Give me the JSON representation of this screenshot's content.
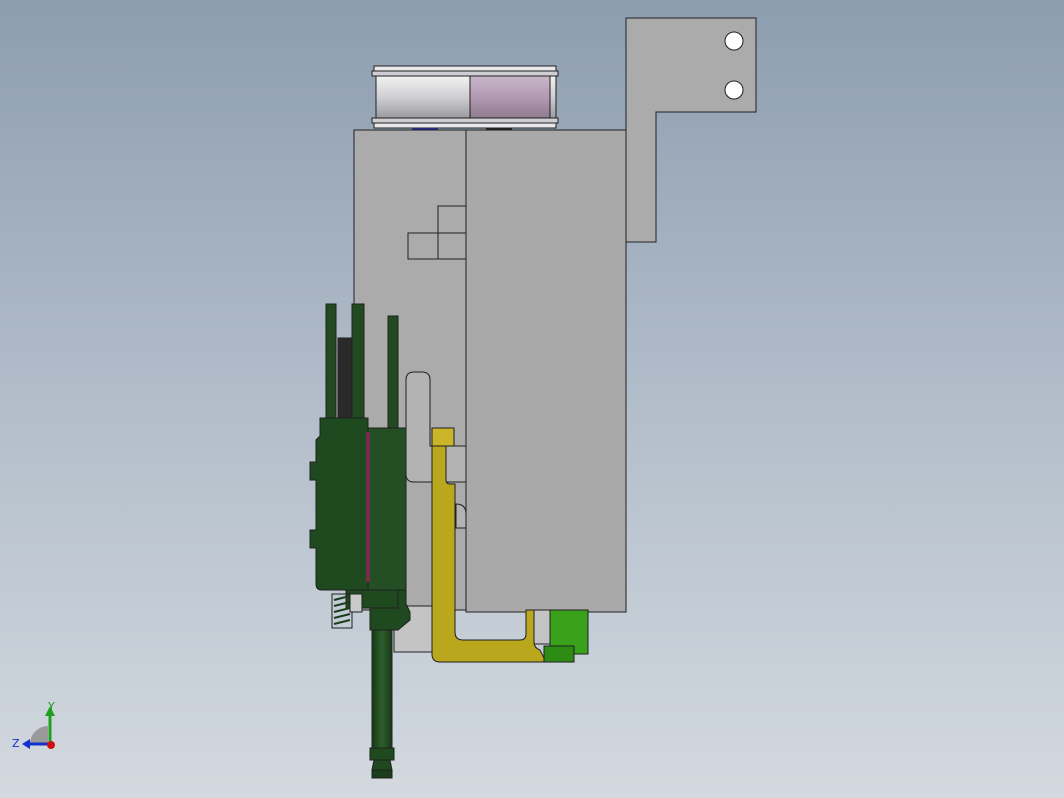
{
  "triad": {
    "y_label": "Y",
    "z_label": "Z",
    "x_color": "#d01010",
    "y_color": "#1fa01f",
    "z_color": "#1530d0"
  },
  "colors": {
    "housing": "#ababab",
    "dark_green": "#1f4a1f",
    "yellow": "#b9a71d",
    "light_green": "#3aa11a",
    "roller": "#d9d9dc",
    "roller_band": "#b8a3b8",
    "edge": "#202020"
  }
}
